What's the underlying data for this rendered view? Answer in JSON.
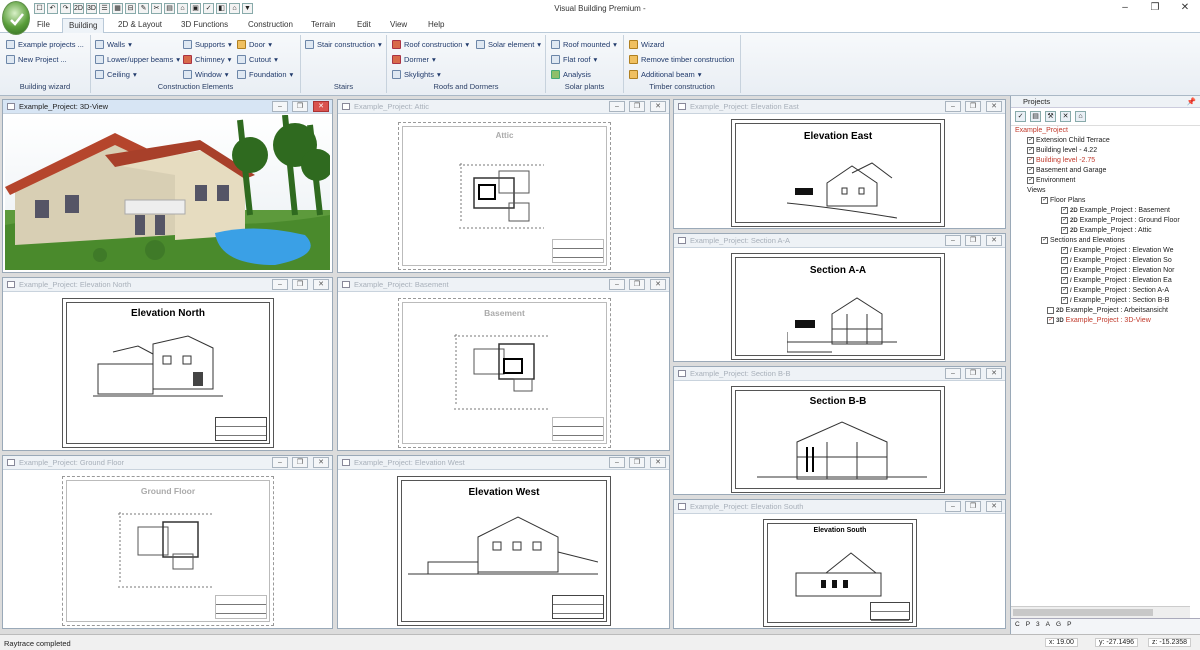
{
  "app": {
    "title": "Visual Building Premium -"
  },
  "quick_access": [
    "☐",
    "↶",
    "↷",
    "2D",
    "3D",
    "☰",
    "▦",
    "⊟",
    "✎",
    "✂",
    "▤",
    "⌂",
    "▣",
    "✓",
    "◧",
    "⌂",
    "▼"
  ],
  "menu": [
    "File",
    "Building",
    "2D & Layout",
    "3D Functions",
    "Construction",
    "Terrain",
    "Edit",
    "View",
    "Help"
  ],
  "ribbon": {
    "wizard": {
      "caption": "Building wizard",
      "items": [
        "Example projects ...",
        "New Project ..."
      ]
    },
    "construction": {
      "caption": "Construction Elements",
      "items": [
        "Walls",
        "Lower/upper beams",
        "Ceiling",
        "Supports",
        "Chimney",
        "Window",
        "Door",
        "Cutout",
        "Foundation"
      ]
    },
    "stairs": {
      "caption": "Stairs",
      "items": [
        "Stair construction"
      ]
    },
    "roofs": {
      "caption": "Roofs and Dormers",
      "items": [
        "Roof construction",
        "Dormer",
        "Skylights",
        "Solar element"
      ]
    },
    "solar": {
      "caption": "Solar plants",
      "items": [
        "Roof mounted",
        "Flat roof",
        "Analysis"
      ]
    },
    "timber": {
      "caption": "Timber construction",
      "items": [
        "Wizard",
        "Remove timber construction",
        "Additional beam"
      ]
    }
  },
  "windows": [
    {
      "title": "Example_Project: 3D-View",
      "sheet": ""
    },
    {
      "title": "Example_Project: Attic",
      "sheet": "Attic"
    },
    {
      "title": "Example_Project: Elevation East",
      "sheet": "Elevation East"
    },
    {
      "title": "Example_Project: Elevation North",
      "sheet": "Elevation North"
    },
    {
      "title": "Example_Project: Basement",
      "sheet": "Basement"
    },
    {
      "title": "Example_Project: Section A-A",
      "sheet": "Section A-A"
    },
    {
      "title": "Example_Project: Section B-B",
      "sheet": "Section B-B"
    },
    {
      "title": "Example_Project: Ground Floor",
      "sheet": "Ground Floor"
    },
    {
      "title": "Example_Project: Elevation West",
      "sheet": "Elevation West"
    },
    {
      "title": "Example_Project: Elevation South",
      "sheet": "Elevation South"
    }
  ],
  "projects": {
    "header": "Projects",
    "tree": [
      "Example_Project",
      "Extension Child Terrace",
      "Building level - 4.22",
      "Building level -2.75",
      "Basement and Garage",
      "Environment",
      "Views",
      "Floor Plans",
      "Example_Project : Basement",
      "Example_Project : Ground Floor",
      "Example_Project : Attic",
      "Sections and Elevations",
      "Example_Project : Elevation We",
      "Example_Project : Elevation So",
      "Example_Project : Elevation Nor",
      "Example_Project : Elevation Ea",
      "Example_Project : Section A-A",
      "Example_Project : Section B-B",
      "Example_Project : Arbeitsansicht",
      "Example_Project : 3D-View"
    ],
    "bottom_tabs": [
      "C",
      "P",
      "3",
      "A",
      "G",
      "P"
    ]
  },
  "status": {
    "text": "Raytrace completed",
    "x": "x: 19.00",
    "y": "y: -27.1496",
    "z": "z: -15.2358"
  }
}
